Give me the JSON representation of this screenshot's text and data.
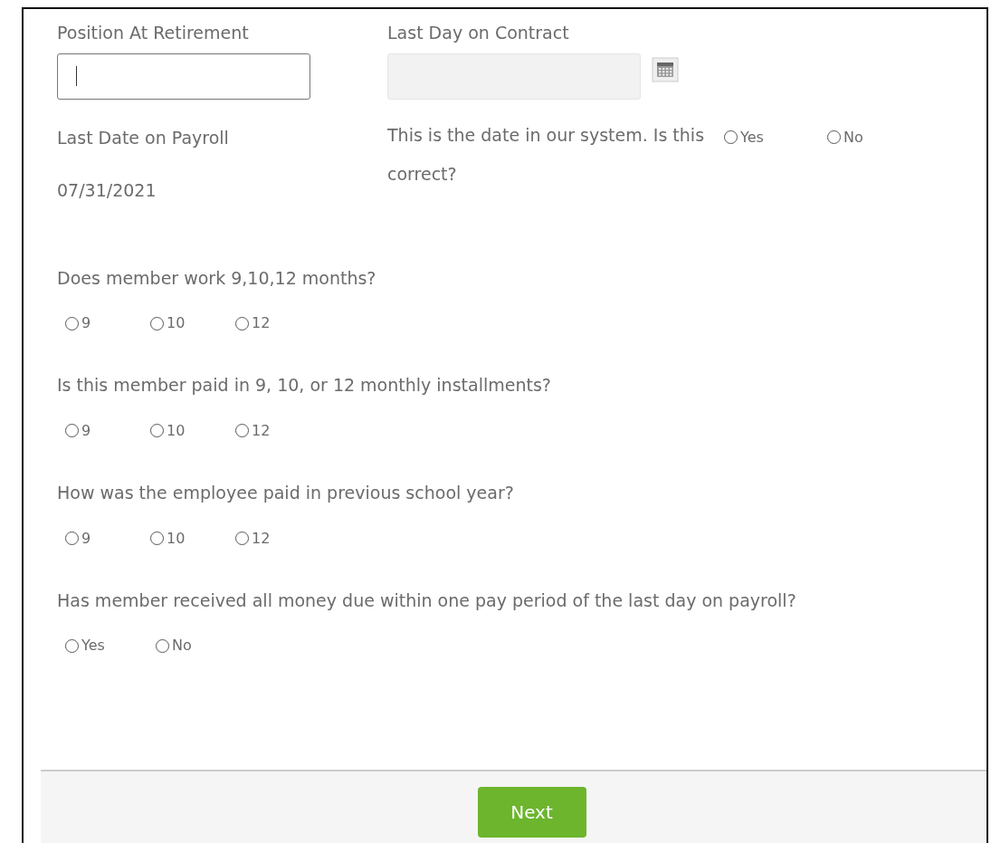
{
  "fields": [
    {
      "label": "Position At Retirement",
      "focused": true,
      "disabled": false
    },
    {
      "label": "Last Day on Contract",
      "focused": false,
      "disabled": true
    }
  ],
  "payroll": {
    "label": "Last Date on Payroll",
    "value": "07/31/2021"
  },
  "confirm": {
    "text": "This is the date in our system. Is this correct?",
    "options": [
      {
        "label": "Yes",
        "selected": false
      },
      {
        "label": "No",
        "selected": false
      }
    ]
  },
  "questions": [
    {
      "text": "Does member work 9,10,12 months?",
      "options": [
        {
          "label": "9",
          "selected": false
        },
        {
          "label": "10",
          "selected": false
        },
        {
          "label": "12",
          "selected": false
        }
      ]
    },
    {
      "text": "Is this member paid in 9, 10, or 12 monthly installments?",
      "options": [
        {
          "label": "9",
          "selected": false
        },
        {
          "label": "10",
          "selected": false
        },
        {
          "label": "12",
          "selected": false
        }
      ]
    },
    {
      "text": "How was the employee paid in previous school year?",
      "options": [
        {
          "label": "9",
          "selected": false
        },
        {
          "label": "10",
          "selected": false
        },
        {
          "label": "12",
          "selected": false
        }
      ]
    },
    {
      "text": "Has member received all money due within one pay period of the last day on payroll?",
      "options": [
        {
          "label": "Yes",
          "selected": false
        },
        {
          "label": "No",
          "selected": false
        }
      ]
    }
  ],
  "footer": {
    "button": "Next"
  }
}
